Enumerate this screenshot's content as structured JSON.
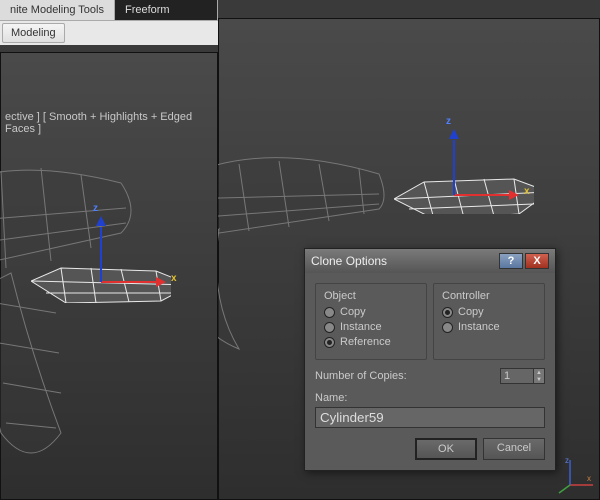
{
  "ribbon": {
    "tab_tools": "nite Modeling Tools",
    "tab_freeform": "Freeform",
    "group_modeling": "Modeling"
  },
  "viewport": {
    "label": "ective ] [ Smooth + Highlights + Edged Faces ]",
    "axis_x": "x",
    "axis_z": "z"
  },
  "dialog": {
    "title": "Clone Options",
    "help": "?",
    "close": "X",
    "object_legend": "Object",
    "controller_legend": "Controller",
    "opt_copy": "Copy",
    "opt_instance": "Instance",
    "opt_reference": "Reference",
    "copies_label": "Number of Copies:",
    "copies_value": "1",
    "name_label": "Name:",
    "name_value": "Cylinder59",
    "ok": "OK",
    "cancel": "Cancel"
  }
}
